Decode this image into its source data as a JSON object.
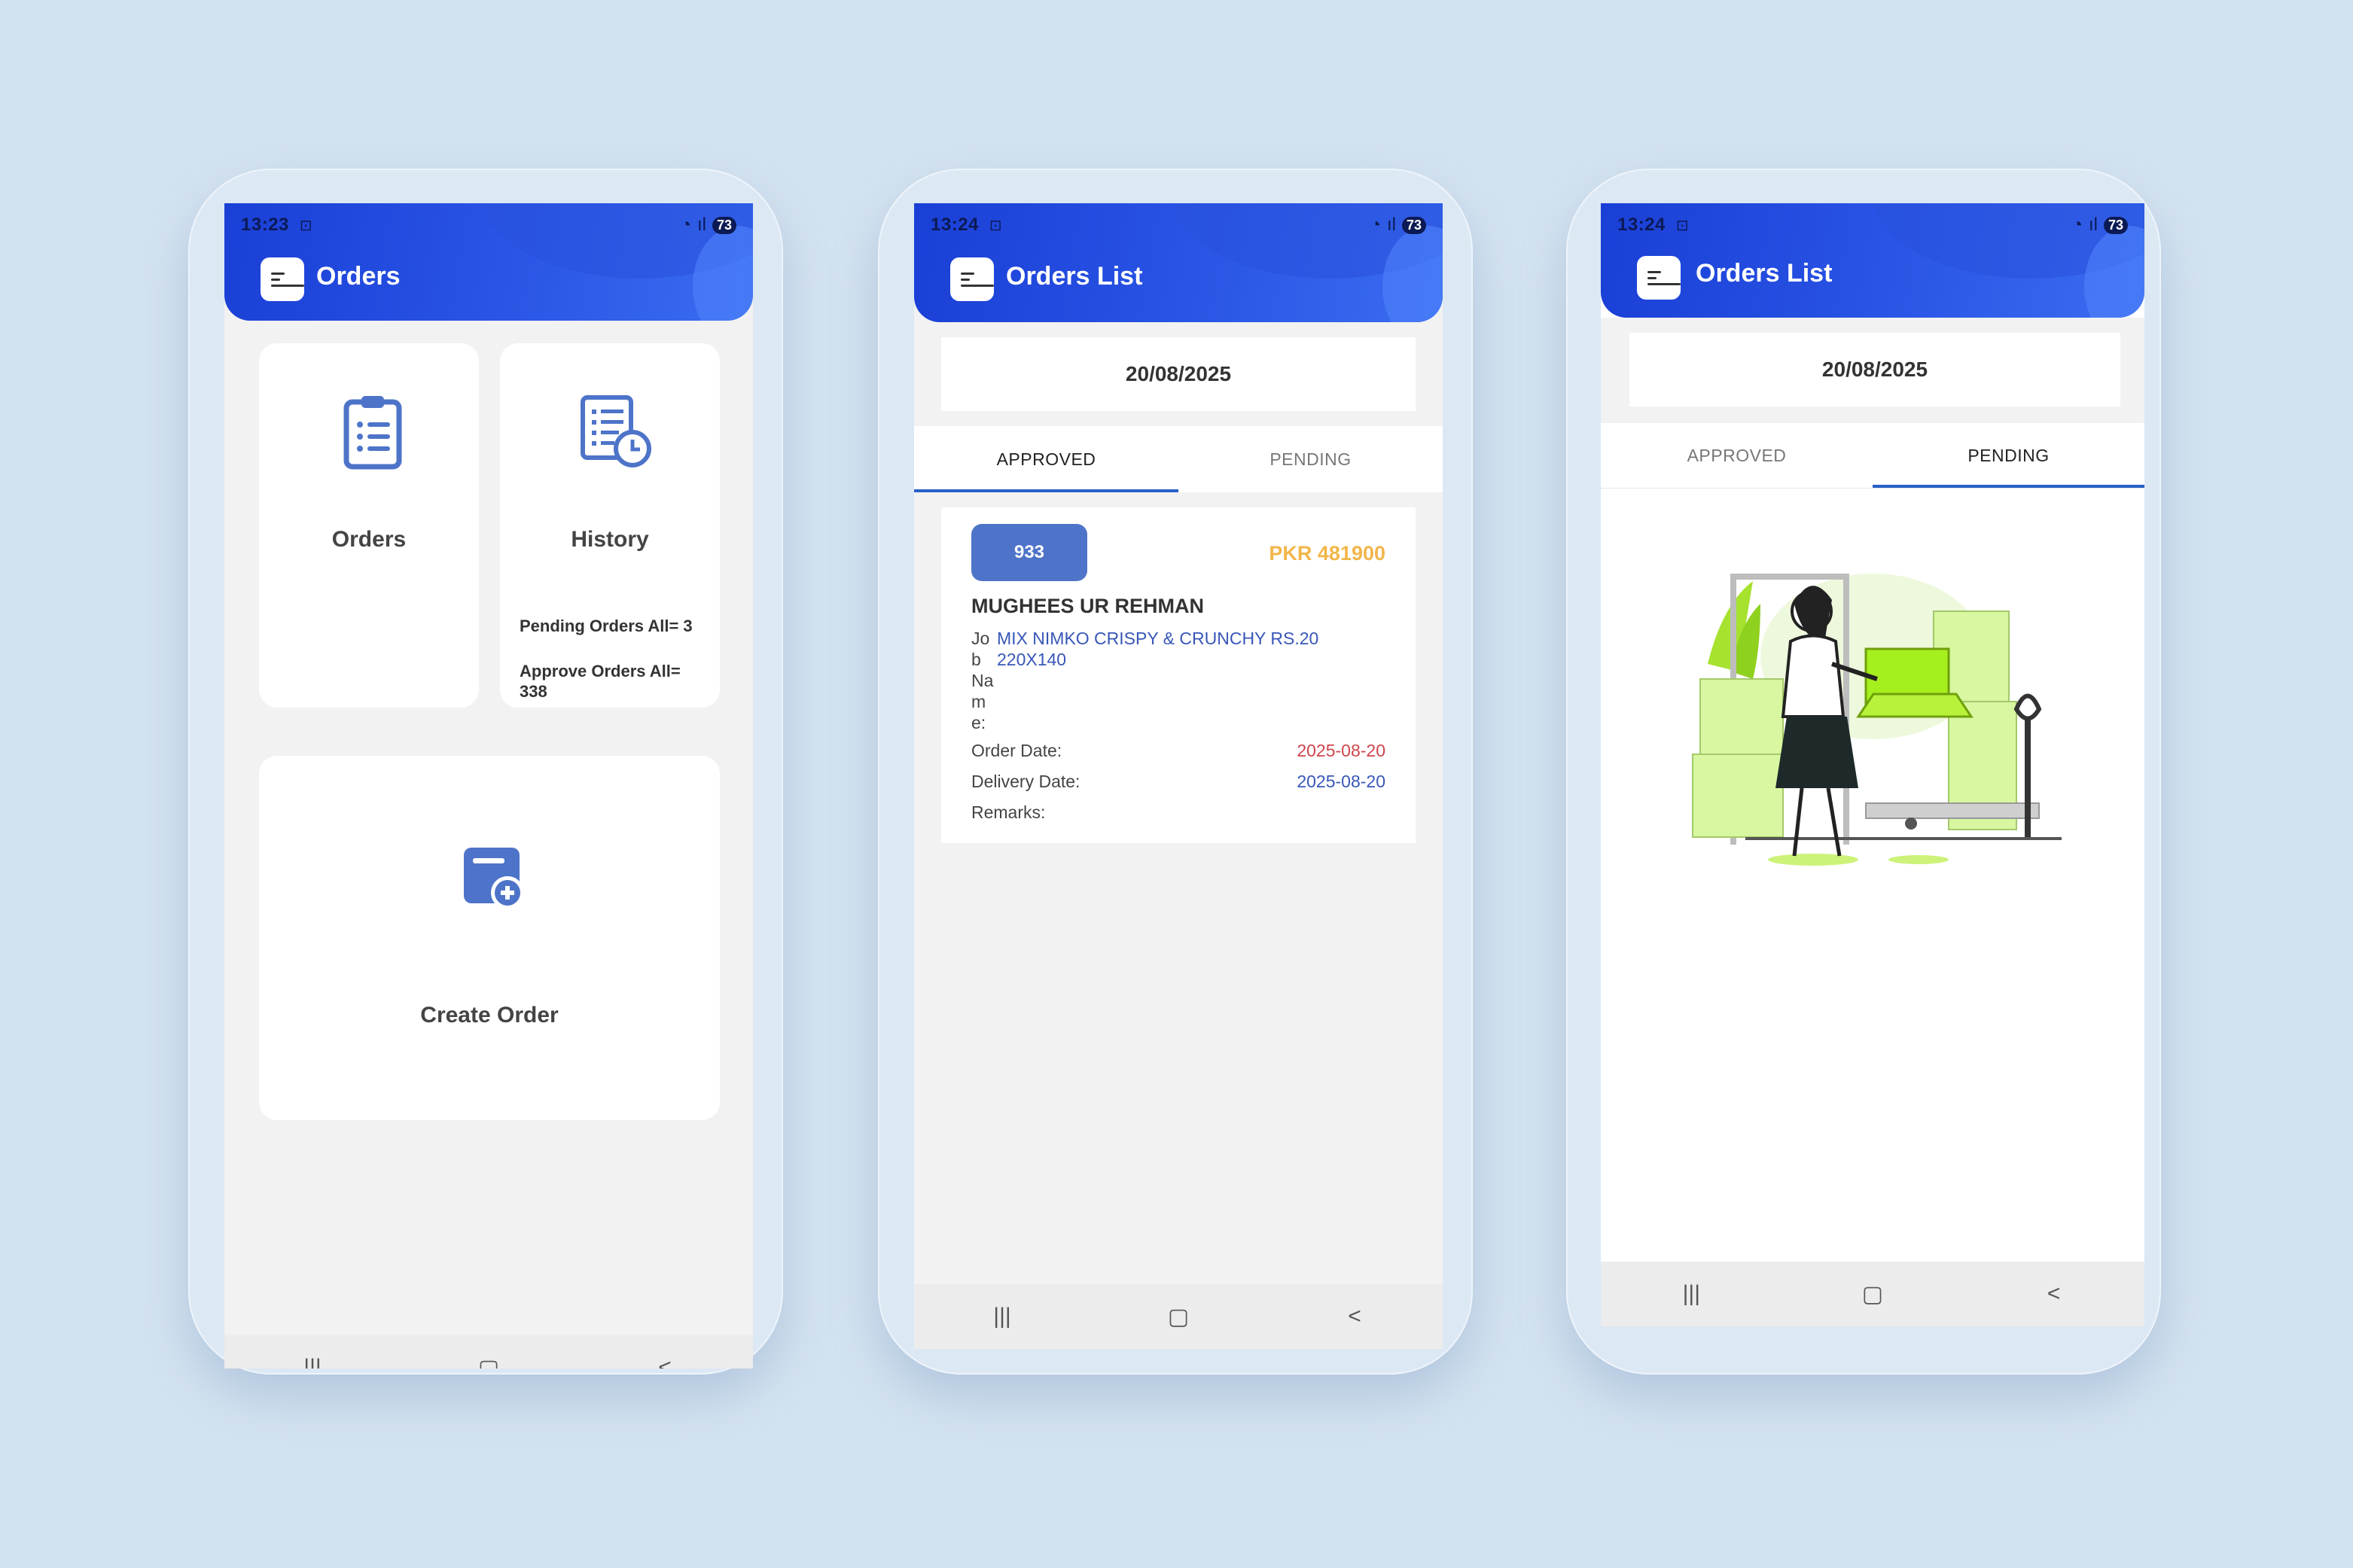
{
  "colors": {
    "background": "#d3e2f0",
    "appbar": "#1f47dc",
    "accent": "#4e74c9",
    "amount": "#f2b64a",
    "order_date": "#d0454c",
    "delivery_date": "#3857b8"
  },
  "nav": {
    "recent": "|||",
    "home": "▢",
    "back": "<"
  },
  "screen1": {
    "status": {
      "time": "13:23",
      "battery": "73"
    },
    "title": "Orders",
    "tiles": {
      "orders": {
        "label": "Orders",
        "icon": "clipboard-list-icon"
      },
      "history": {
        "label": "History",
        "icon": "history-list-icon",
        "pending": "Pending Orders All= 3",
        "approve": "Approve Orders All= 338"
      },
      "create": {
        "label": "Create Order",
        "icon": "create-order-icon"
      }
    }
  },
  "screen2": {
    "status": {
      "time": "13:24",
      "battery": "73"
    },
    "title": "Orders List",
    "date": "20/08/2025",
    "tabs": [
      "APPROVED",
      "PENDING"
    ],
    "active_tab": "APPROVED",
    "order": {
      "id": "933",
      "amount": "PKR 481900",
      "customer": "MUGHEES UR REHMAN",
      "job_label": "Job Name:",
      "job_name": "MIX NIMKO CRISPY & CRUNCHY RS.20 220X140",
      "order_date_label": "Order Date:",
      "order_date": "2025-08-20",
      "delivery_date_label": "Delivery Date:",
      "delivery_date": "2025-08-20",
      "remarks_label": "Remarks:"
    }
  },
  "screen3": {
    "status": {
      "time": "13:24",
      "battery": "73"
    },
    "title": "Orders List",
    "date": "20/08/2025",
    "tabs": [
      "APPROVED",
      "PENDING"
    ],
    "active_tab": "PENDING",
    "empty_illustration": "warehouse-woman-boxes-illustration"
  }
}
